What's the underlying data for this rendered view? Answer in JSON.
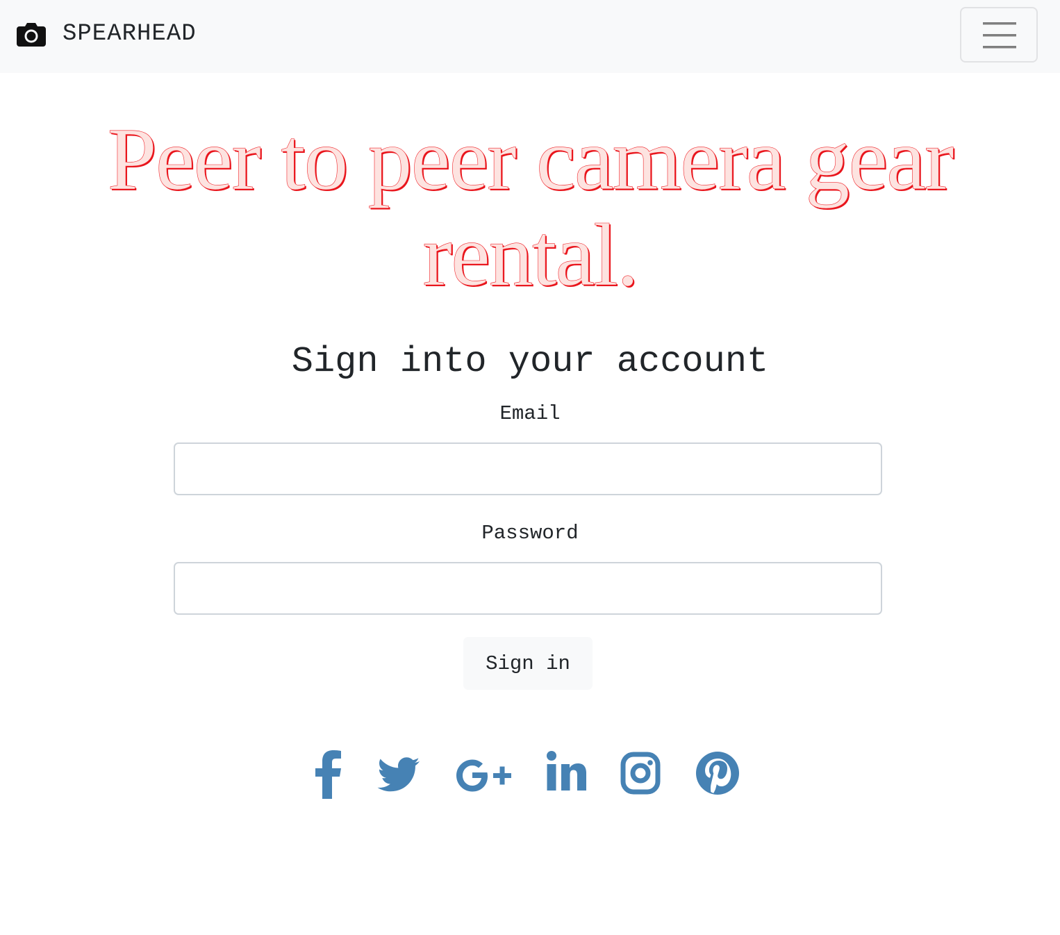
{
  "navbar": {
    "brand_icon": "camera-icon",
    "brand_text": "SPEARHEAD",
    "toggler_icon": "hamburger-menu-icon"
  },
  "hero": {
    "line1": "Peer to peer camera gear",
    "line2": "rental."
  },
  "signin_form": {
    "title": "Sign into your account",
    "email_label": "Email",
    "email_value": "",
    "password_label": "Password",
    "password_value": "",
    "submit_label": "Sign in"
  },
  "social": {
    "icons": [
      "facebook-icon",
      "twitter-icon",
      "google-plus-icon",
      "linkedin-icon",
      "instagram-icon",
      "pinterest-icon"
    ]
  },
  "colors": {
    "navbar_bg": "#f8f9fa",
    "hero_fill": "#fde3e0",
    "hero_outline": "#e8141b",
    "social_icon": "#4682b4",
    "button_bg": "#f8f9fa",
    "input_border": "#ced4da"
  }
}
